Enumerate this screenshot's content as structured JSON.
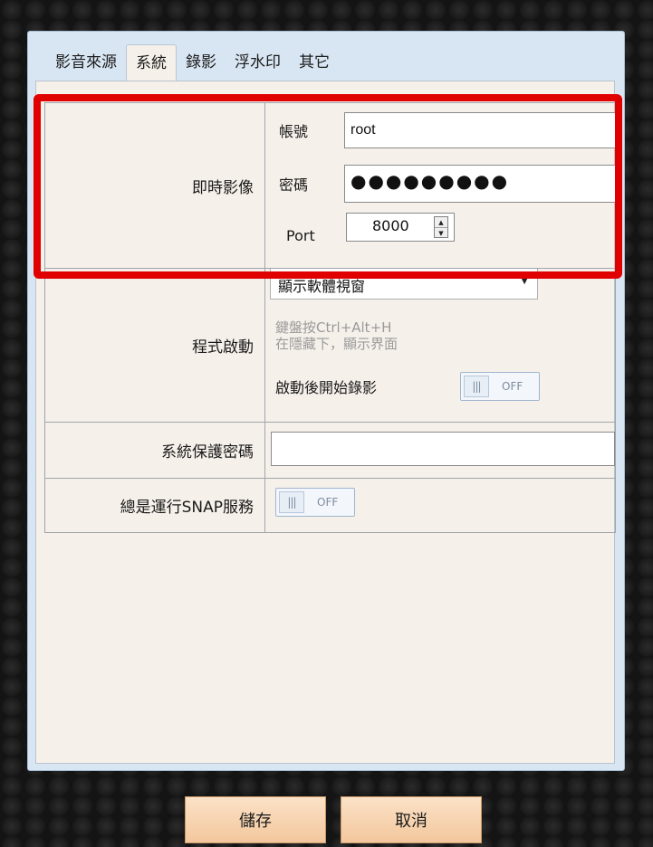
{
  "tabs": [
    "影音來源",
    "系統",
    "錄影",
    "浮水印",
    "其它"
  ],
  "active_tab": "系統",
  "live_video": {
    "label": "即時影像",
    "account_label": "帳號",
    "account_value": "root",
    "password_label": "密碼",
    "password_masked": "●●●●●●●●●",
    "port_label": "Port",
    "port_value": "8000"
  },
  "startup": {
    "label": "程式啟動",
    "select_value": "顯示軟體視窗",
    "hint_line1": "鍵盤按Ctrl+Alt+H",
    "hint_line2": "在隱藏下，顯示界面",
    "record_label": "啟動後開始錄影",
    "record_toggle": "OFF"
  },
  "system_password": {
    "label": "系統保護密碼",
    "value": ""
  },
  "snap_service": {
    "label": "總是運行SNAP服務",
    "toggle": "OFF"
  },
  "buttons": {
    "save": "儲存",
    "cancel": "取消"
  },
  "highlight_color": "#e10000"
}
